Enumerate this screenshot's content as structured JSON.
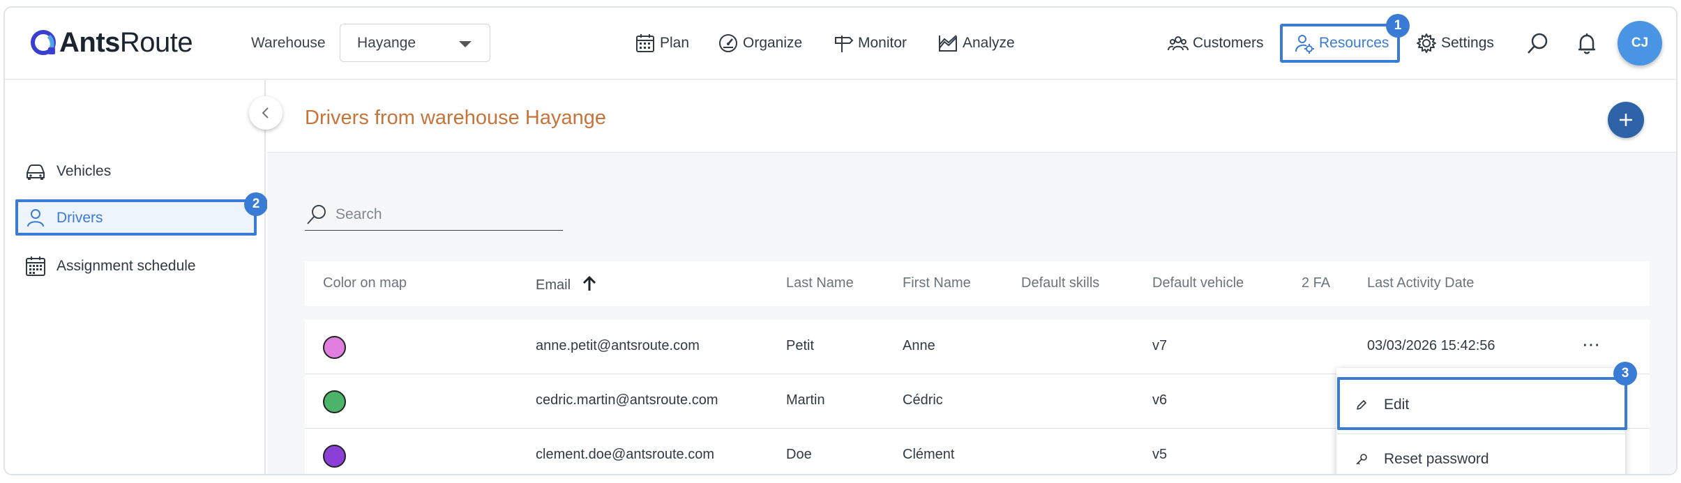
{
  "app": {
    "logo_text_bold": "Ants",
    "logo_text_light": "Route"
  },
  "header": {
    "warehouse_label": "Warehouse",
    "warehouse_value": "Hayange",
    "nav": [
      {
        "label": "Plan",
        "icon": "calendar-icon"
      },
      {
        "label": "Organize",
        "icon": "speedometer-icon"
      },
      {
        "label": "Monitor",
        "icon": "signpost-icon"
      },
      {
        "label": "Analyze",
        "icon": "chart-area-icon"
      }
    ],
    "right_nav": [
      {
        "label": "Customers",
        "icon": "users-icon"
      },
      {
        "label": "Resources",
        "icon": "user-gear-icon",
        "active": true
      },
      {
        "label": "Settings",
        "icon": "gear-icon"
      }
    ],
    "avatar_initials": "CJ",
    "step_badges": [
      "1",
      "2",
      "3"
    ]
  },
  "sidebar": {
    "items": [
      {
        "label": "Vehicles",
        "icon": "car-icon"
      },
      {
        "label": "Drivers",
        "icon": "user-icon",
        "active": true
      },
      {
        "label": "Assignment schedule",
        "icon": "calendar-grid-icon"
      }
    ]
  },
  "main": {
    "title": "Drivers from warehouse Hayange",
    "search_placeholder": "Search",
    "columns": [
      "Color on map",
      "Email",
      "Last Name",
      "First Name",
      "Default skills",
      "Default vehicle",
      "2 FA",
      "Last Activity Date"
    ],
    "sort": {
      "column": "Email",
      "direction": "ascending"
    },
    "rows": [
      {
        "color": "#e07fe0",
        "email": "anne.petit@antsroute.com",
        "last_name": "Petit",
        "first_name": "Anne",
        "skills": "",
        "vehicle": "v7",
        "twofa": "",
        "last_activity": "03/03/2026 15:42:56"
      },
      {
        "color": "#4cb56a",
        "email": "cedric.martin@antsroute.com",
        "last_name": "Martin",
        "first_name": "Cédric",
        "skills": "",
        "vehicle": "v6",
        "twofa": "",
        "last_activity": ""
      },
      {
        "color": "#8a3fd6",
        "email": "clement.doe@antsroute.com",
        "last_name": "Doe",
        "first_name": "Clément",
        "skills": "",
        "vehicle": "v5",
        "twofa": "",
        "last_activity": ""
      }
    ],
    "row_menu": [
      {
        "label": "Edit",
        "icon": "pencil-icon"
      },
      {
        "label": "Reset password",
        "icon": "key-icon"
      }
    ]
  },
  "colors": {
    "accent": "#3a7bd5",
    "title": "#c7743a",
    "add_button": "#2e63a8"
  }
}
